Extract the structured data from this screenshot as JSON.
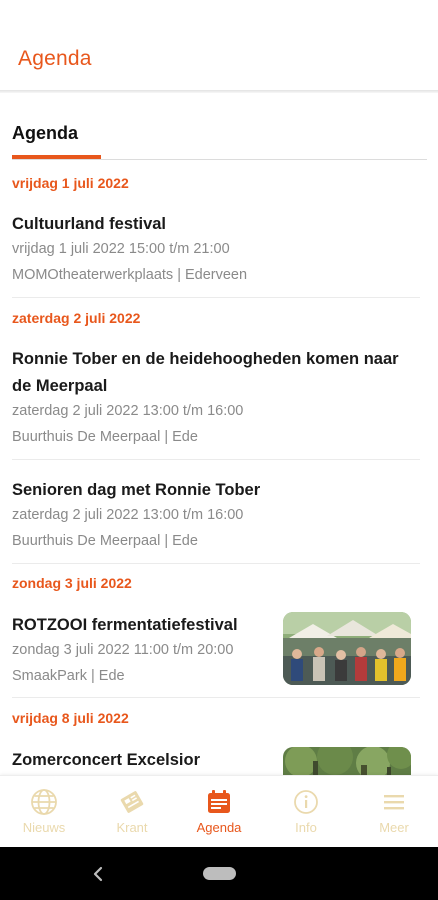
{
  "appbar": {
    "title": "Agenda"
  },
  "tab": {
    "label": "Agenda"
  },
  "days": [
    {
      "date": "vrijdag 1 juli 2022",
      "events": [
        {
          "title": "Cultuurland festival",
          "time": "vrijdag 1 juli 2022 15:00 t/m 21:00",
          "location": "MOMOtheaterwerkplaats | Ederveen"
        }
      ]
    },
    {
      "date": "zaterdag 2 juli 2022",
      "events": [
        {
          "title_line1": "Ronnie Tober en de heidehoogheden komen naar",
          "title_line2": "de Meerpaal",
          "time": "zaterdag 2 juli 2022 13:00 t/m 16:00",
          "location": "Buurthuis De Meerpaal | Ede"
        },
        {
          "title": "Senioren dag met Ronnie Tober",
          "time": "zaterdag 2 juli 2022 13:00 t/m 16:00",
          "location": "Buurthuis De Meerpaal | Ede"
        }
      ]
    },
    {
      "date": "zondag 3 juli 2022",
      "events": [
        {
          "title": "ROTZOOI fermentatiefestival",
          "time": "zondag 3 juli 2022 11:00 t/m 20:00",
          "location": "SmaakPark | Ede"
        }
      ]
    },
    {
      "date": "vrijdag 8 juli 2022",
      "events": [
        {
          "title": "Zomerconcert Excelsior"
        }
      ]
    }
  ],
  "bottom_nav": [
    {
      "label": "Nieuws",
      "icon": "globe-icon",
      "active": false
    },
    {
      "label": "Krant",
      "icon": "newspaper-icon",
      "active": false
    },
    {
      "label": "Agenda",
      "icon": "calendar-icon",
      "active": true
    },
    {
      "label": "Info",
      "icon": "info-icon",
      "active": false
    },
    {
      "label": "Meer",
      "icon": "menu-icon",
      "active": false
    }
  ],
  "colors": {
    "accent": "#e8571c",
    "nav_inactive": "#ead9ad",
    "muted_text": "#8a8a8a"
  }
}
